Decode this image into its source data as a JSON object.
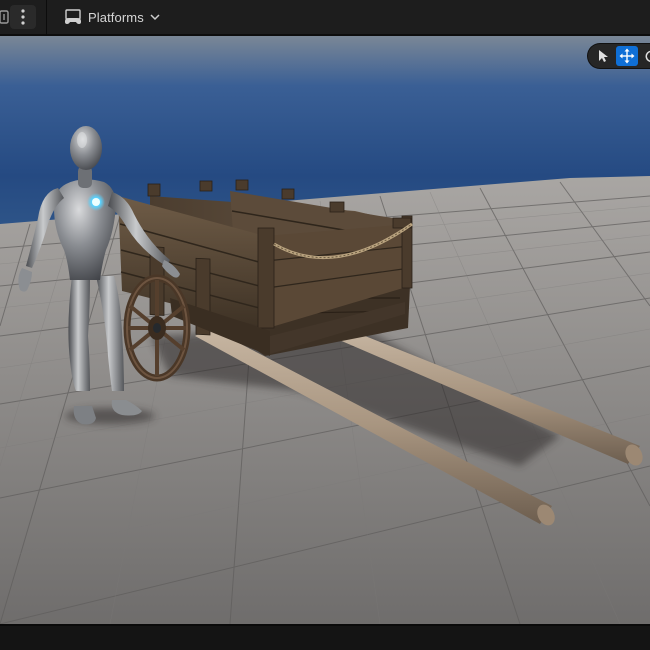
{
  "toolbar": {
    "platforms_label": "Platforms",
    "left_icon": "panel-edge-icon",
    "more_icon": "kebab-menu-icon",
    "platforms_icon": "gamepad-monitor-icon",
    "dropdown_icon": "chevron-down-icon"
  },
  "viewport": {
    "transform_tools": [
      {
        "name": "select-mode",
        "icon": "cursor-arrow-icon",
        "active": false
      },
      {
        "name": "translate-mode",
        "icon": "move-arrows-icon",
        "active": true
      },
      {
        "name": "rotate-mode",
        "icon": "rotate-icon",
        "active": false
      }
    ],
    "scene_objects": [
      "mannequin",
      "wooden-cart",
      "grid-floor",
      "sky"
    ]
  },
  "colors": {
    "toolbar_bg": "#1d1d1d",
    "accent_active": "#0f6fd6",
    "text": "#d6d6d6",
    "sky_top": "#23406f",
    "floor": "#8d8c8c"
  }
}
